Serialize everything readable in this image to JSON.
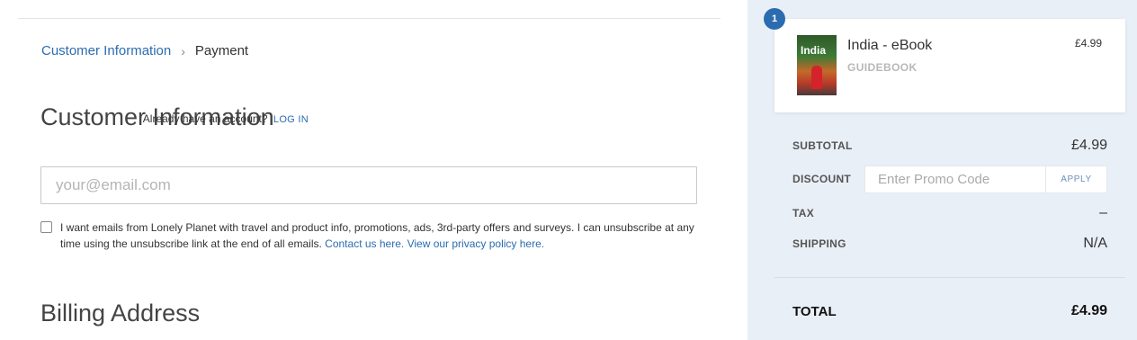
{
  "breadcrumb": {
    "step1": "Customer Information",
    "separator": "›",
    "step2": "Payment"
  },
  "customer": {
    "heading": "Customer Information",
    "account_prompt": "Already have an account?",
    "login_link": "LOG IN",
    "email_placeholder": "your@email.com",
    "email_value": "",
    "optin_checked": false,
    "optin_text": "I want emails from Lonely Planet with travel and product info, promotions, ads, 3rd-party offers and surveys. I can unsubscribe at any time using the unsubscribe link at the end of all emails. ",
    "contact_link": "Contact us here.",
    "privacy_link": "View our privacy policy here."
  },
  "billing": {
    "heading": "Billing Address"
  },
  "cart": {
    "quantity": "1",
    "item": {
      "name": "India - eBook",
      "type": "GUIDEBOOK",
      "price": "£4.99",
      "cover_title": "India"
    },
    "summary": {
      "subtotal_label": "SUBTOTAL",
      "subtotal_value": "£4.99",
      "discount_label": "DISCOUNT",
      "promo_placeholder": "Enter Promo Code",
      "apply_label": "APPLY",
      "tax_label": "TAX",
      "tax_value": "–",
      "shipping_label": "SHIPPING",
      "shipping_value": "N/A",
      "total_label": "TOTAL",
      "total_value": "£4.99"
    }
  },
  "colors": {
    "link": "#2b6cb0",
    "sidebar_bg": "#e9eff6",
    "badge": "#2b6cb0"
  }
}
